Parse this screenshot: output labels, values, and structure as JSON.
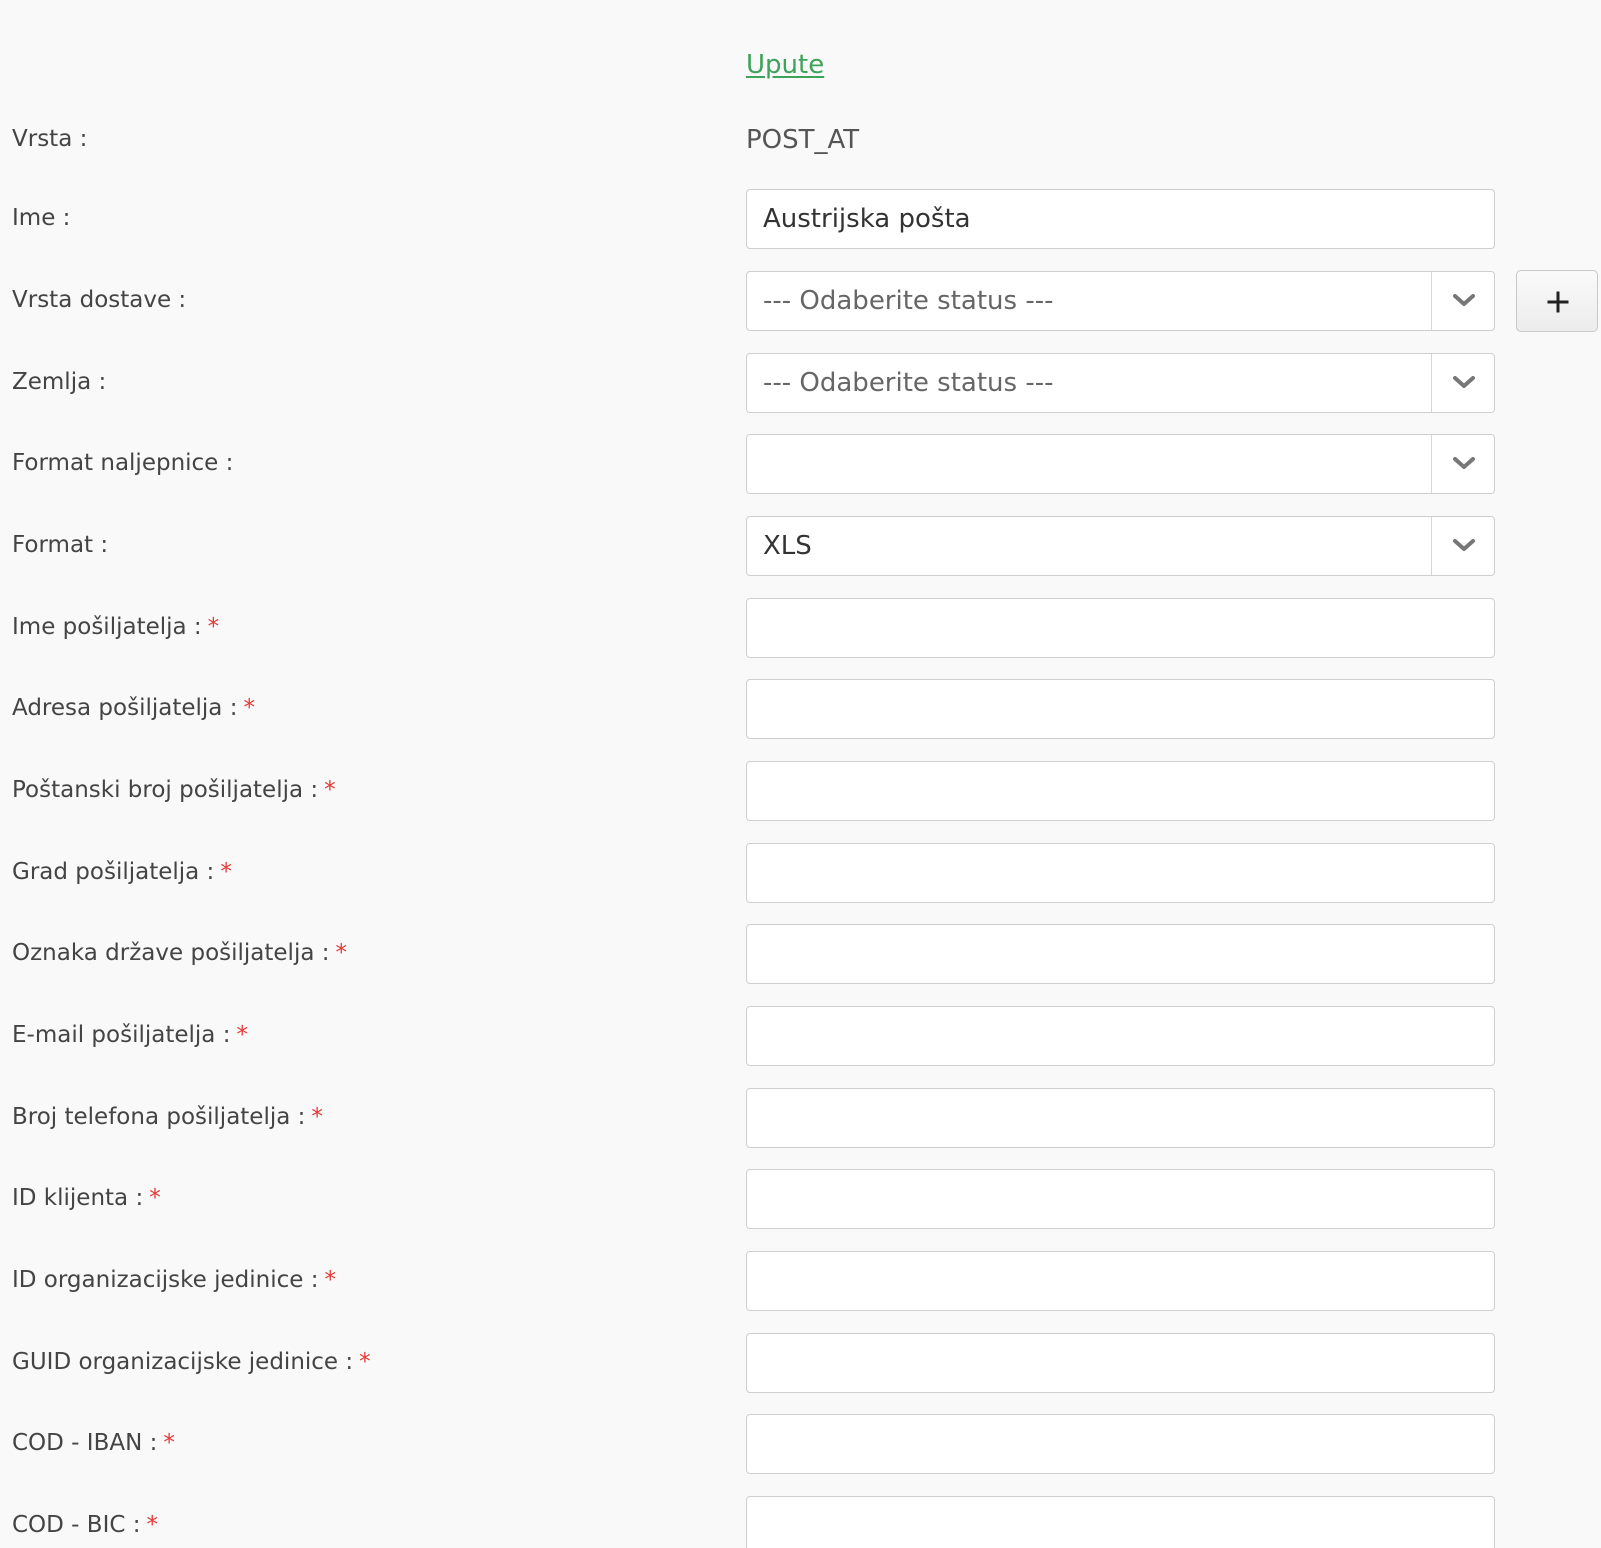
{
  "help_link": "Upute",
  "type_row": {
    "label": "Vrsta :",
    "value": "POST_AT"
  },
  "name_row": {
    "label": "Ime :",
    "value": "Austrijska pošta"
  },
  "delivery_type": {
    "label": "Vrsta dostave :",
    "value": "--- Odaberite status ---",
    "add_icon": "plus-icon"
  },
  "country": {
    "label": "Zemlja :",
    "value": "--- Odaberite status ---"
  },
  "label_format": {
    "label": "Format naljepnice :",
    "value": ""
  },
  "format": {
    "label": "Format :",
    "value": "XLS"
  },
  "required_marker": "*",
  "required_fields": [
    {
      "label": "Ime pošiljatelja :",
      "value": ""
    },
    {
      "label": "Adresa pošiljatelja :",
      "value": ""
    },
    {
      "label": "Poštanski broj pošiljatelja :",
      "value": ""
    },
    {
      "label": "Grad pošiljatelja :",
      "value": ""
    },
    {
      "label": "Oznaka države pošiljatelja :",
      "value": ""
    },
    {
      "label": "E-mail pošiljatelja :",
      "value": ""
    },
    {
      "label": "Broj telefona pošiljatelja :",
      "value": ""
    },
    {
      "label": "ID klijenta :",
      "value": ""
    },
    {
      "label": "ID organizacijske jedinice :",
      "value": ""
    },
    {
      "label": "GUID organizacijske jedinice :",
      "value": ""
    },
    {
      "label": "COD - IBAN :",
      "value": ""
    },
    {
      "label": "COD - BIC :",
      "value": ""
    }
  ],
  "colors": {
    "link": "#3ea35a",
    "required": "#e53935",
    "background": "#f9f9f9"
  }
}
